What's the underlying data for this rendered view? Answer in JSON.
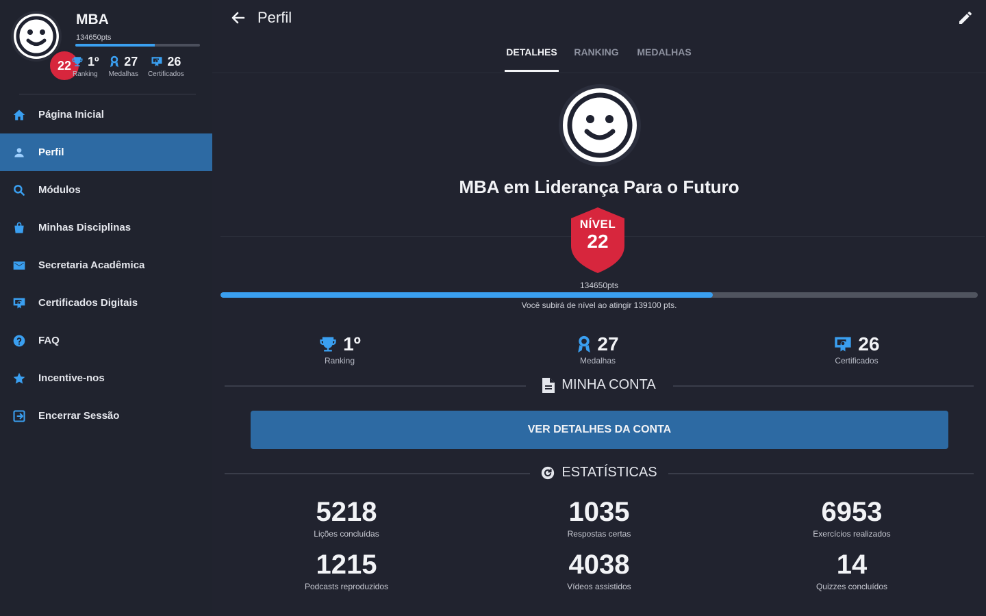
{
  "sidebar": {
    "profile": {
      "name": "MBA",
      "points": "134650pts",
      "level": "22",
      "progress_fraction": 0.64,
      "stats": [
        {
          "value": "1º",
          "label": "Ranking",
          "icon": "trophy-icon"
        },
        {
          "value": "27",
          "label": "Medalhas",
          "icon": "medal-icon"
        },
        {
          "value": "26",
          "label": "Certificados",
          "icon": "certificate-icon"
        }
      ]
    },
    "menu": [
      {
        "label": "Página Inicial",
        "icon": "home-icon"
      },
      {
        "label": "Perfil",
        "icon": "person-icon",
        "active": true
      },
      {
        "label": "Módulos",
        "icon": "search-icon"
      },
      {
        "label": "Minhas Disciplinas",
        "icon": "bag-icon"
      },
      {
        "label": "Secretaria Acadêmica",
        "icon": "mail-icon"
      },
      {
        "label": "Certificados Digitais",
        "icon": "certificate-icon"
      },
      {
        "label": "FAQ",
        "icon": "help-icon"
      },
      {
        "label": "Incentive-nos",
        "icon": "star-icon"
      },
      {
        "label": "Encerrar Sessão",
        "icon": "logout-icon"
      }
    ]
  },
  "header": {
    "title": "Perfil",
    "tabs": [
      "DETALHES",
      "RANKING",
      "MEDALHAS"
    ]
  },
  "profile": {
    "course_title": "MBA em Liderança Para o Futuro",
    "level_label": "NÍVEL",
    "level_value": "22",
    "points": "134650pts",
    "progress_fraction": 0.65,
    "next_level_text": "Você subirá de nível ao atingir 139100 pts.",
    "stats": [
      {
        "value": "1º",
        "label": "Ranking"
      },
      {
        "value": "27",
        "label": "Medalhas"
      },
      {
        "value": "26",
        "label": "Certificados"
      }
    ]
  },
  "account": {
    "section_title": "MINHA CONTA",
    "button_label": "VER DETALHES DA CONTA"
  },
  "statistics": {
    "section_title": "ESTATÍSTICAS",
    "items": [
      {
        "value": "5218",
        "label": "Lições concluídas"
      },
      {
        "value": "1035",
        "label": "Respostas certas"
      },
      {
        "value": "6953",
        "label": "Exercícios realizados"
      },
      {
        "value": "1215",
        "label": "Podcasts reproduzidos"
      },
      {
        "value": "4038",
        "label": "Vídeos assistidos"
      },
      {
        "value": "14",
        "label": "Quizzes concluídos"
      }
    ]
  },
  "colors": {
    "background": "#21232f",
    "accent": "#2d6aa3",
    "progress": "#3a9ff0",
    "badge_red": "#d7263d"
  }
}
